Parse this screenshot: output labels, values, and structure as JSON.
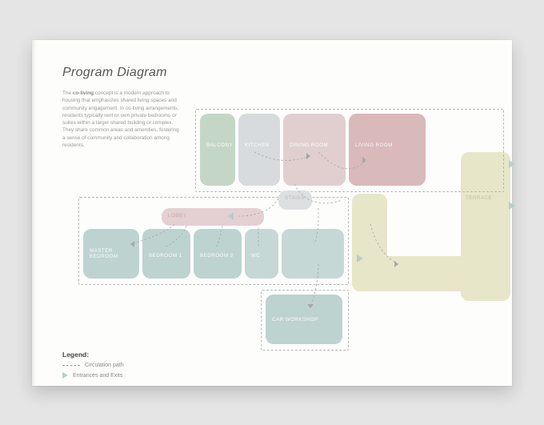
{
  "title": "Program Diagram",
  "paragraph_lead": "co-living",
  "paragraph": " concept is a modern approach to housing that emphasizes shared living spaces and community engagement. In co-living arrangements, residents typically rent or own private bedrooms or suites within a larger shared building or complex. They share common areas and amenities, fostering a sense of community and collaboration among residents.",
  "paragraph_prefix": "The ",
  "rooms": {
    "balcony": {
      "label": "BALCONY",
      "sub": ""
    },
    "kitchen": {
      "label": "KITCHEN",
      "sub": ""
    },
    "dining": {
      "label": "DINING ROOM",
      "sub": ""
    },
    "living": {
      "label": "LIVING ROOM",
      "sub": ""
    },
    "terrace": {
      "label": "TERRACE",
      "sub": ""
    },
    "stairs": {
      "label": "STAIRS",
      "sub": ""
    },
    "lobby": {
      "label": "LOBBY",
      "sub": ""
    },
    "master": {
      "label": "MASTER BEDROOM",
      "sub": ""
    },
    "bed1": {
      "label": "BEDROOM 1",
      "sub": ""
    },
    "bed2": {
      "label": "BEDROOM 2",
      "sub": ""
    },
    "wc": {
      "label": "WC",
      "sub": ""
    },
    "workshop": {
      "label": "CAR WORKSHOP",
      "sub": ""
    }
  },
  "legend": {
    "heading": "Legend:",
    "circulation": "Circulation path",
    "entrances": "Entrances and Exits"
  }
}
